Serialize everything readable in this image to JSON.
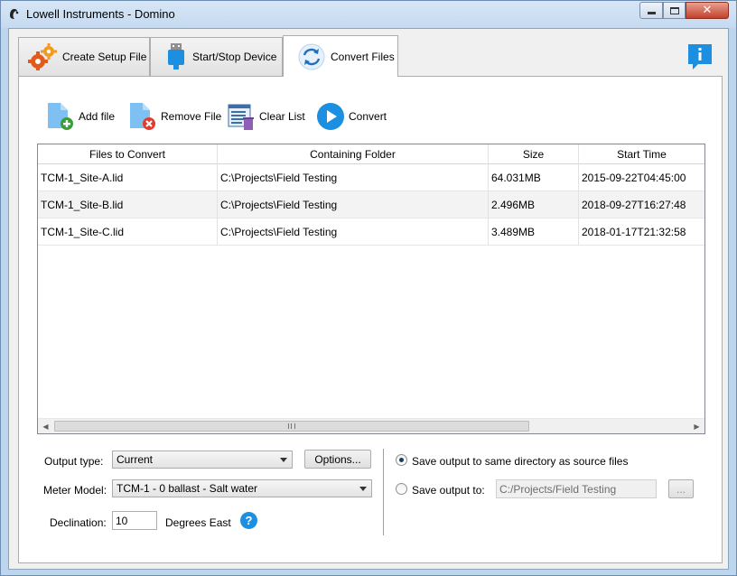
{
  "window": {
    "title": "Lowell Instruments - Domino",
    "controls": {
      "minimize": "–",
      "maximize": "□",
      "close": "✕"
    }
  },
  "tabs": [
    {
      "label": "Create Setup File",
      "icon": "gears-icon",
      "active": false
    },
    {
      "label": "Start/Stop Device",
      "icon": "usb-device-icon",
      "active": false
    },
    {
      "label": "Convert Files",
      "icon": "sync-arrows-icon",
      "active": true
    }
  ],
  "info_icon": "info-chat-icon",
  "toolbar": {
    "add_file": "Add file",
    "remove_file": "Remove File",
    "clear_list": "Clear List",
    "convert": "Convert"
  },
  "table": {
    "columns": [
      "Files to Convert",
      "Containing Folder",
      "Size",
      "Start Time"
    ],
    "rows": [
      [
        "TCM-1_Site-A.lid",
        "C:\\Projects\\Field Testing",
        "64.031MB",
        "2015-09-22T04:45:00"
      ],
      [
        "TCM-1_Site-B.lid",
        "C:\\Projects\\Field Testing",
        "2.496MB",
        "2018-09-27T16:27:48"
      ],
      [
        "TCM-1_Site-C.lid",
        "C:\\Projects\\Field Testing",
        "3.489MB",
        "2018-01-17T21:32:58"
      ]
    ]
  },
  "form": {
    "output_type_label": "Output type:",
    "output_type_value": "Current",
    "options_button": "Options...",
    "meter_model_label": "Meter Model:",
    "meter_model_value": "TCM-1 - 0 ballast - Salt water",
    "declination_label": "Declination:",
    "declination_value": "10",
    "declination_unit": "Degrees East",
    "help": "?",
    "save_same_dir_label": "Save output to same directory as source files",
    "save_same_dir_checked": true,
    "save_output_to_label": "Save output to:",
    "save_output_to_checked": false,
    "save_output_path": "C:/Projects/Field Testing",
    "browse_button": "..."
  },
  "colors": {
    "accent_blue": "#1d8fe1",
    "remove_red": "#e23b2e",
    "add_green": "#3a9d3a"
  }
}
